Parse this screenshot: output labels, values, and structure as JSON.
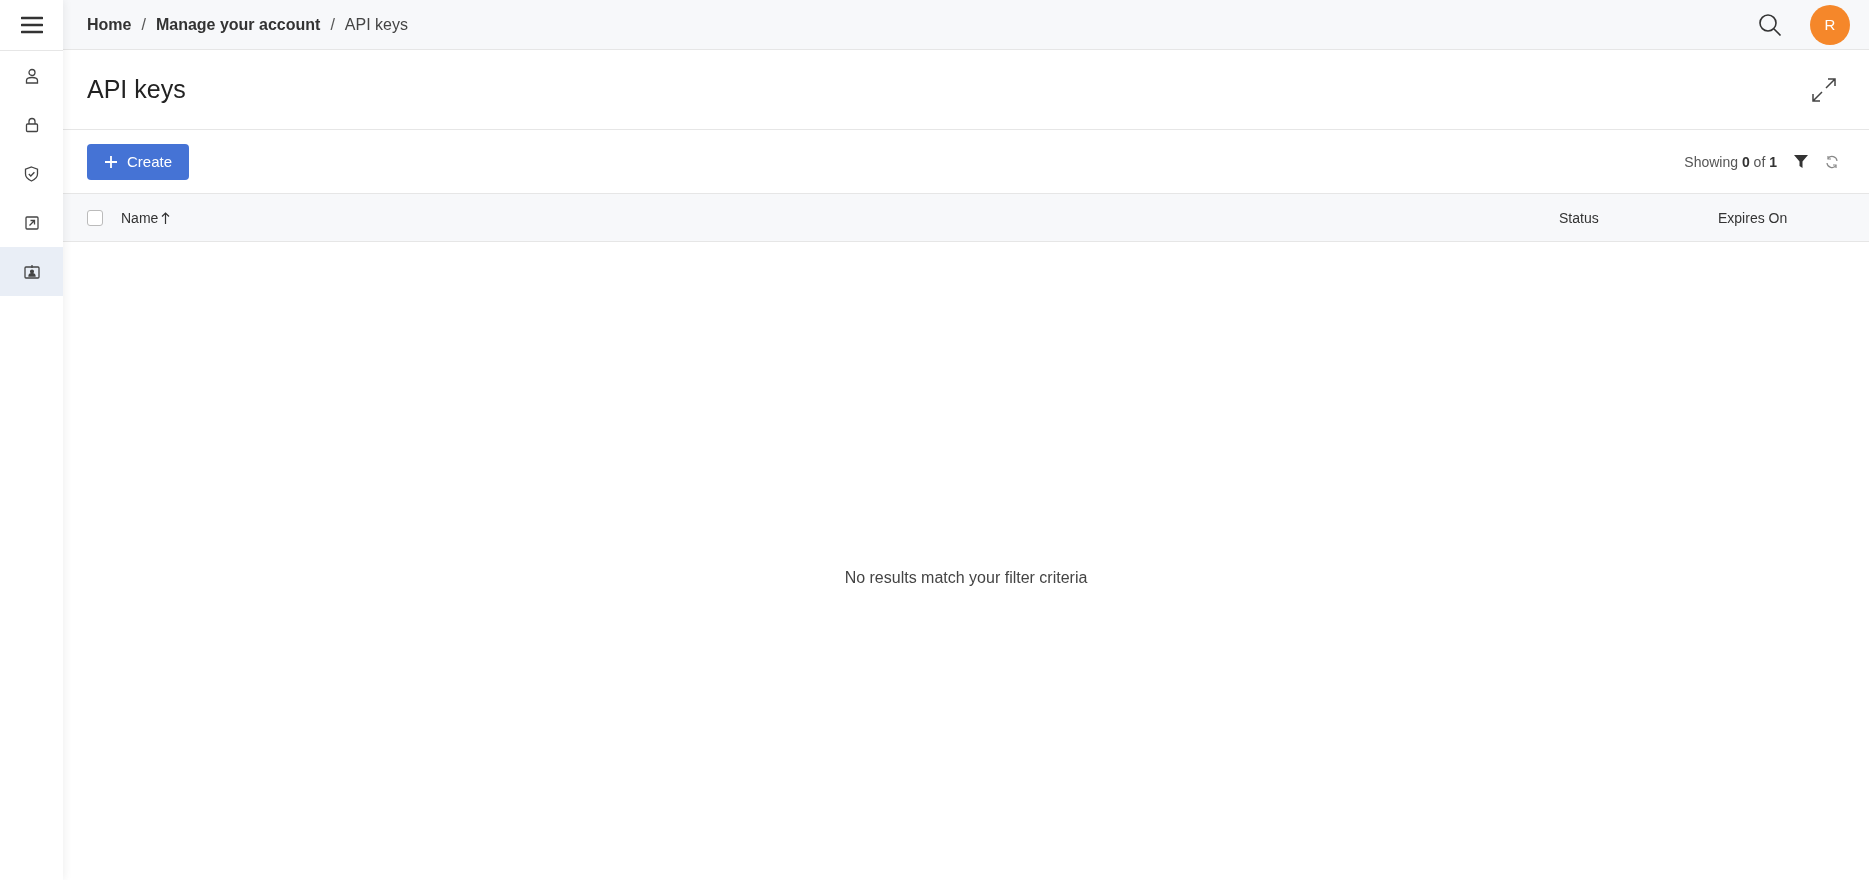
{
  "sidebar": {
    "items": [
      {
        "kind": "person",
        "selected": false
      },
      {
        "kind": "lock",
        "selected": false
      },
      {
        "kind": "shield",
        "selected": false
      },
      {
        "kind": "external",
        "selected": false
      },
      {
        "kind": "badge",
        "selected": true
      }
    ]
  },
  "breadcrumb": [
    {
      "label": "Home",
      "kind": "link"
    },
    {
      "separator": "/",
      "label": "Manage your account",
      "kind": "link"
    },
    {
      "separator": "/",
      "label": "API keys",
      "kind": "current"
    }
  ],
  "avatar": {
    "initial": "R",
    "color": "#f5872a"
  },
  "page_title": "API keys",
  "toolbar": {
    "create_button": "Create",
    "showing": "Showing **0** of **1**"
  },
  "table": {
    "select_all_checked": false,
    "columns": [
      {
        "label": "Name",
        "sorted_ascending": true
      },
      {
        "label": "Status",
        "sorted_ascending": false
      },
      {
        "label": "Expires On",
        "sorted_ascending": false
      }
    ],
    "empty_message": "No results match your filter criteria"
  }
}
